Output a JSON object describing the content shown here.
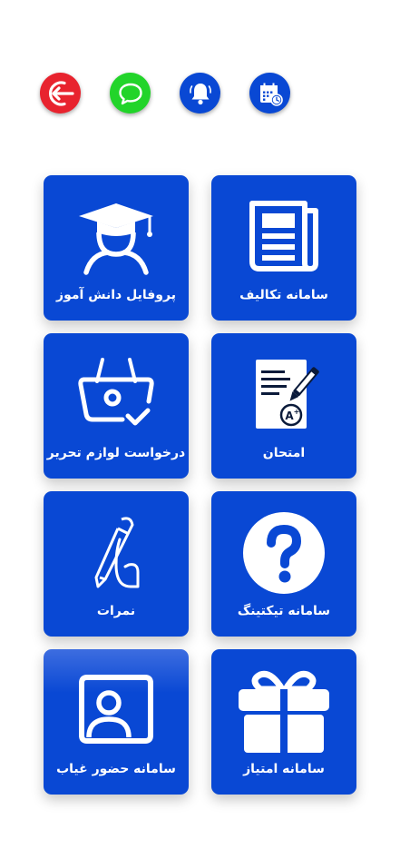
{
  "colors": {
    "tile_bg": "#0948d4",
    "logout": "#e8232e",
    "messages": "#22d42a",
    "notifications": "#0948d4",
    "calendar": "#0948d4",
    "icon_fg": "#ffffff"
  },
  "top_actions": [
    {
      "id": "logout",
      "icon": "logout-icon"
    },
    {
      "id": "messages",
      "icon": "chat-bubble-icon"
    },
    {
      "id": "notifications",
      "icon": "bell-icon"
    },
    {
      "id": "calendar",
      "icon": "calendar-clock-icon"
    }
  ],
  "tiles": {
    "assignments": {
      "label": "سامانه تکالیف",
      "icon": "newspaper-icon"
    },
    "student_profile": {
      "label": "پروفایل دانش آموز",
      "icon": "graduate-icon"
    },
    "exam": {
      "label": "امتحان",
      "icon": "exam-paper-icon"
    },
    "stationery_request": {
      "label": "درخواست لوازم تحریر",
      "icon": "shopping-basket-icon"
    },
    "ticketing": {
      "label": "سامانه تیکتینگ",
      "icon": "question-icon"
    },
    "grades": {
      "label": "نمرات",
      "icon": "pen-icon"
    },
    "rewards": {
      "label": "سامانه امتیاز",
      "icon": "gift-icon"
    },
    "attendance": {
      "label": "سامانه حضور غیاب",
      "icon": "id-card-icon"
    }
  }
}
